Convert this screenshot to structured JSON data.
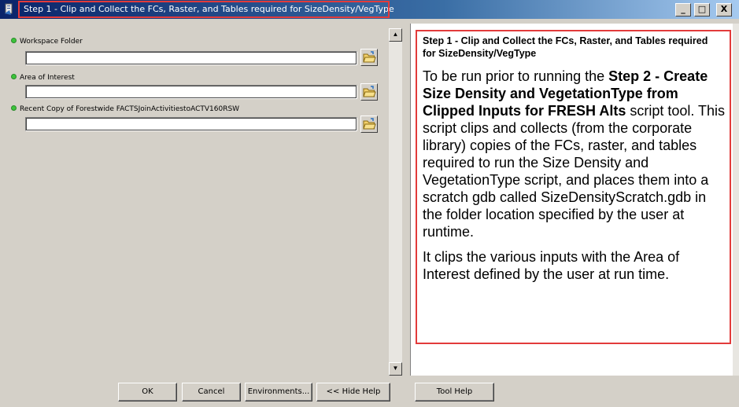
{
  "window": {
    "title": "Step 1 - Clip and Collect the FCs, Raster, and Tables required for SizeDensity/VegType",
    "minimize_label": "_",
    "maximize_label": "□",
    "close_label": "X",
    "title_icon": "app-icon"
  },
  "parameters": [
    {
      "label": "Workspace Folder",
      "value": "",
      "icon": "folder-browse-icon"
    },
    {
      "label": "Area of Interest",
      "value": "",
      "icon": "folder-browse-icon"
    },
    {
      "label": "Recent Copy of Forestwide FACTSJoinActivitiestoACTV160RSW",
      "value": "",
      "icon": "folder-browse-icon"
    }
  ],
  "help": {
    "title": "Step 1 - Clip and Collect the FCs, Raster, and Tables required for SizeDensity/VegType",
    "para1_prefix": "To be run prior to running the ",
    "para1_bold": "Step 2 - Create Size Density and VegetationType from Clipped Inputs for FRESH Alts",
    "para1_suffix": " script tool. This script clips and collects (from the corporate library) copies of the FCs, raster, and tables required to run the Size Density and VegetationType script, and places them into a scratch gdb called SizeDensityScratch.gdb in the folder location specified by the user at runtime.",
    "para2": "It clips the various inputs with the Area of Interest defined by the user at run time."
  },
  "buttons": {
    "ok": "OK",
    "cancel": "Cancel",
    "environments": "Environments...",
    "hide_help": "<< Hide Help",
    "tool_help": "Tool Help"
  },
  "colors": {
    "highlight": "#e23b3b",
    "required_dot": "#3cc43c"
  }
}
